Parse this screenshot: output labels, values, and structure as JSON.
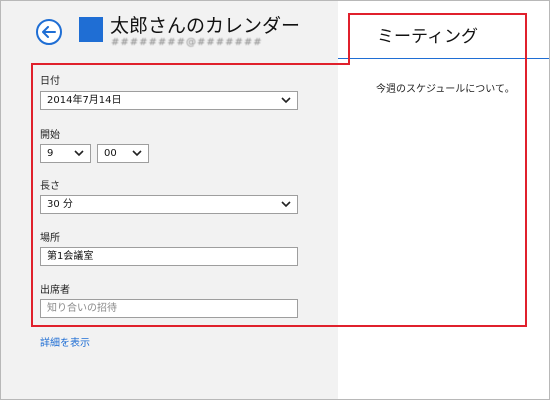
{
  "header": {
    "calendar_title": "太郎さんのカレンダー",
    "account": "########@#######"
  },
  "form": {
    "date": {
      "label": "日付",
      "value": "2014年7月14日"
    },
    "start": {
      "label": "開始",
      "hour": "9",
      "minute": "00"
    },
    "duration": {
      "label": "長さ",
      "value": "30 分"
    },
    "location": {
      "label": "場所",
      "value": "第1会議室"
    },
    "attendees": {
      "label": "出席者",
      "placeholder": "知り合いの招待"
    },
    "details_link": "詳細を表示"
  },
  "event": {
    "title": "ミーティング",
    "description": "今週のスケジュールについて。"
  },
  "colors": {
    "accent": "#1f6ed4",
    "highlight": "#e0202c",
    "left_pane_bg": "#f2f2f2"
  }
}
